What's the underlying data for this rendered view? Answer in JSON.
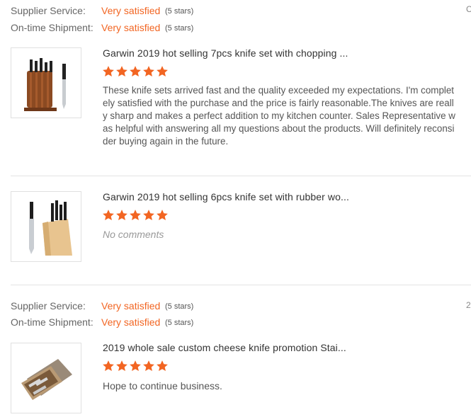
{
  "feedback1": {
    "rows": [
      {
        "label": "Supplier Service:",
        "value": "Very satisfied",
        "stars": "(5 stars)"
      },
      {
        "label": "On-time Shipment:",
        "value": "Very satisfied",
        "stars": "(5 stars)"
      }
    ],
    "edge_text": "C",
    "items": [
      {
        "title": "Garwin 2019 hot selling 7pcs knife set with chopping ...",
        "rating": 5,
        "comment": "These knife sets arrived fast and the quality exceeded my expectations. I'm completely satisfied with the purchase and the price is fairly reasonable.The knives are really sharp and makes a  perfect addition to my kitchen counter. Sales Representative was helpful with answering all my questions about the products. Will definitely reconsider buying again in the future.",
        "image_icon": "knife-set-block-icon"
      },
      {
        "title": "Garwin 2019 hot selling 6pcs knife set with rubber wo...",
        "rating": 5,
        "comment": "No comments",
        "image_icon": "knife-set-wood-block-icon"
      }
    ]
  },
  "feedback2": {
    "rows": [
      {
        "label": "Supplier Service:",
        "value": "Very satisfied",
        "stars": "(5 stars)"
      },
      {
        "label": "On-time Shipment:",
        "value": "Very satisfied",
        "stars": "(5 stars)"
      }
    ],
    "edge_text": "2",
    "items": [
      {
        "title": "2019 whole sale custom cheese knife promotion Stai...",
        "rating": 5,
        "comment": "Hope to continue business.",
        "image_icon": "cheese-knife-box-icon"
      }
    ]
  },
  "colors": {
    "accent": "#f26522",
    "star": "#f26522",
    "divider": "#e3e3e3"
  }
}
